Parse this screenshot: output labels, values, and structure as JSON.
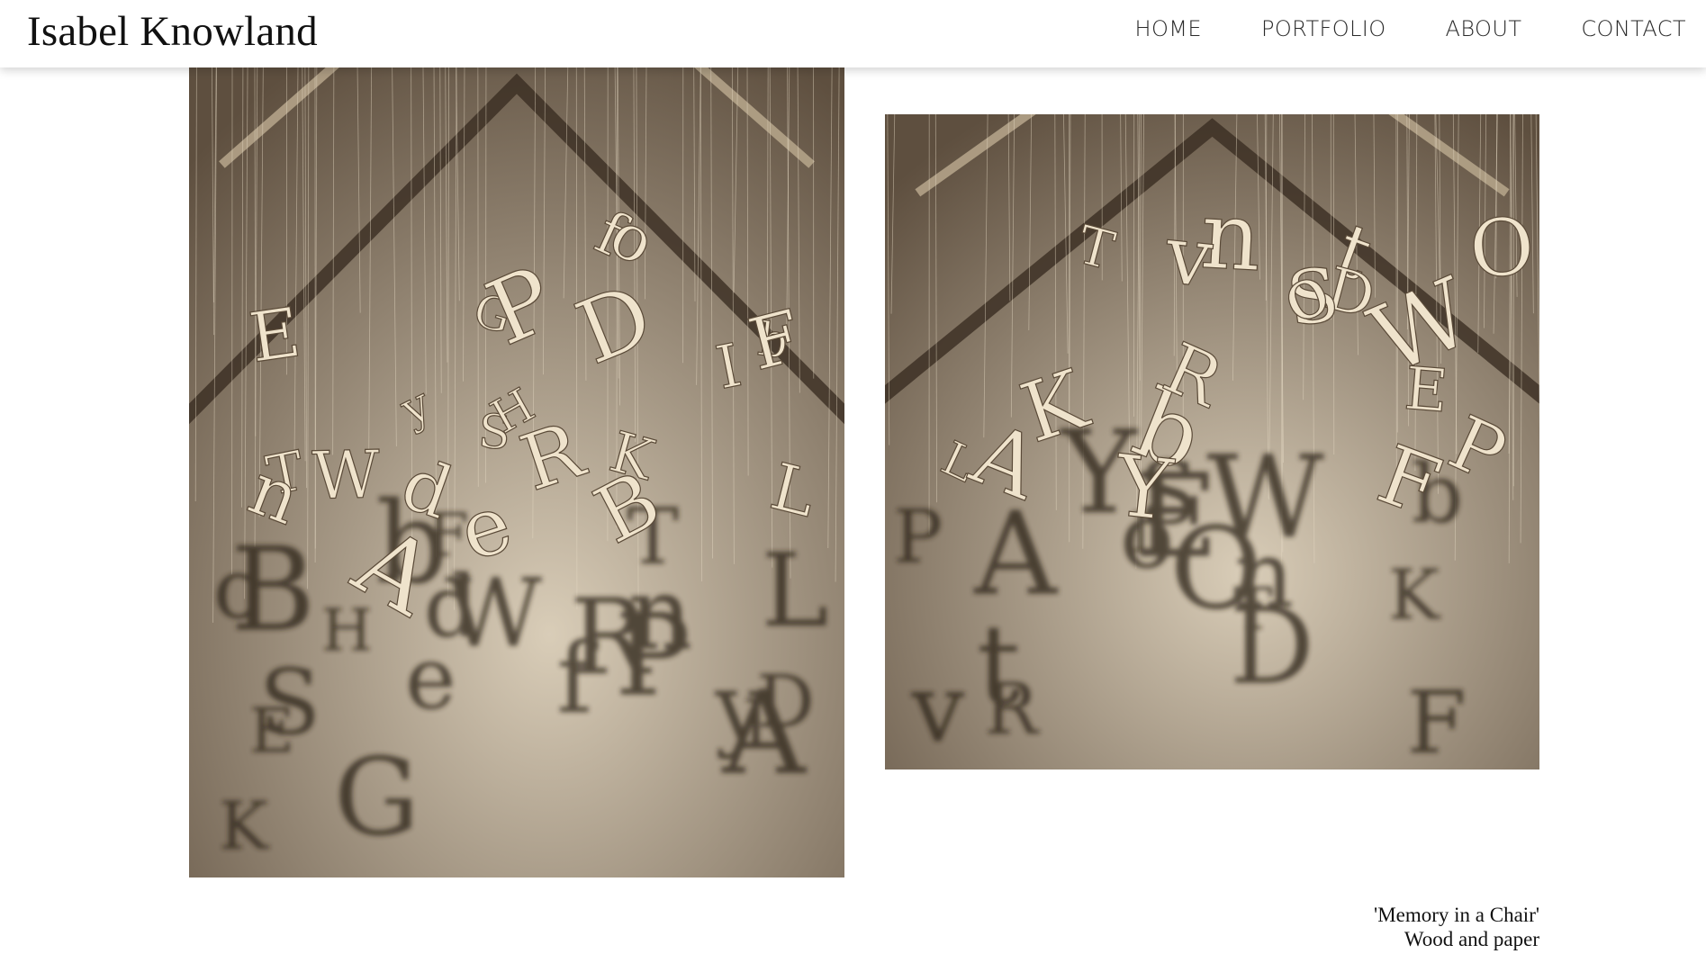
{
  "site": {
    "title": "Isabel Knowland"
  },
  "nav": {
    "items": [
      "HOME",
      "PORTFOLIO",
      "ABOUT",
      "CONTACT"
    ]
  },
  "artwork": {
    "title": "'Memory in a Chair'",
    "medium": "Wood and paper"
  },
  "colors": {
    "wall_light": "#d9cdb8",
    "wall_dark": "#5e4f3f",
    "paper": "#efe3cc",
    "shadow": "#2b2118"
  },
  "letters": {
    "left": [
      "L",
      "S",
      "A",
      "T",
      "K",
      "G",
      "n",
      "D",
      "b",
      "H",
      "E",
      "e",
      "W",
      "P",
      "R",
      "f",
      "B",
      "F",
      "o",
      "d",
      "y",
      "I"
    ],
    "right": [
      "K",
      "t",
      "n",
      "D",
      "W",
      "b",
      "v",
      "L",
      "E",
      "O",
      "P",
      "S",
      "A",
      "T",
      "R",
      "Y",
      "o",
      "F"
    ]
  }
}
